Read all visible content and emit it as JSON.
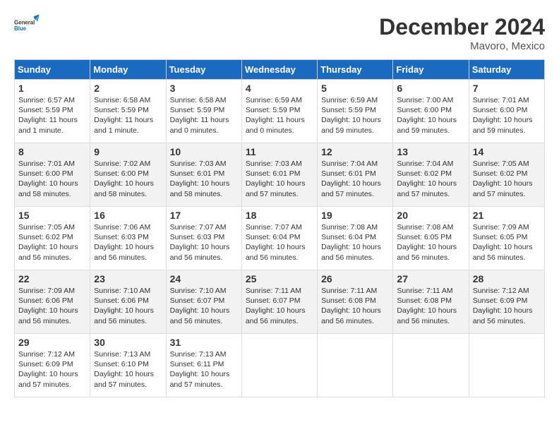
{
  "header": {
    "logo_line1": "General",
    "logo_line2": "Blue",
    "month": "December 2024",
    "location": "Mavoro, Mexico"
  },
  "weekdays": [
    "Sunday",
    "Monday",
    "Tuesday",
    "Wednesday",
    "Thursday",
    "Friday",
    "Saturday"
  ],
  "weeks": [
    [
      {
        "day": "1",
        "info": "Sunrise: 6:57 AM\nSunset: 5:59 PM\nDaylight: 11 hours\nand 1 minute."
      },
      {
        "day": "2",
        "info": "Sunrise: 6:58 AM\nSunset: 5:59 PM\nDaylight: 11 hours\nand 1 minute."
      },
      {
        "day": "3",
        "info": "Sunrise: 6:58 AM\nSunset: 5:59 PM\nDaylight: 11 hours\nand 0 minutes."
      },
      {
        "day": "4",
        "info": "Sunrise: 6:59 AM\nSunset: 5:59 PM\nDaylight: 11 hours\nand 0 minutes."
      },
      {
        "day": "5",
        "info": "Sunrise: 6:59 AM\nSunset: 5:59 PM\nDaylight: 10 hours\nand 59 minutes."
      },
      {
        "day": "6",
        "info": "Sunrise: 7:00 AM\nSunset: 6:00 PM\nDaylight: 10 hours\nand 59 minutes."
      },
      {
        "day": "7",
        "info": "Sunrise: 7:01 AM\nSunset: 6:00 PM\nDaylight: 10 hours\nand 59 minutes."
      }
    ],
    [
      {
        "day": "8",
        "info": "Sunrise: 7:01 AM\nSunset: 6:00 PM\nDaylight: 10 hours\nand 58 minutes."
      },
      {
        "day": "9",
        "info": "Sunrise: 7:02 AM\nSunset: 6:00 PM\nDaylight: 10 hours\nand 58 minutes."
      },
      {
        "day": "10",
        "info": "Sunrise: 7:03 AM\nSunset: 6:01 PM\nDaylight: 10 hours\nand 58 minutes."
      },
      {
        "day": "11",
        "info": "Sunrise: 7:03 AM\nSunset: 6:01 PM\nDaylight: 10 hours\nand 57 minutes."
      },
      {
        "day": "12",
        "info": "Sunrise: 7:04 AM\nSunset: 6:01 PM\nDaylight: 10 hours\nand 57 minutes."
      },
      {
        "day": "13",
        "info": "Sunrise: 7:04 AM\nSunset: 6:02 PM\nDaylight: 10 hours\nand 57 minutes."
      },
      {
        "day": "14",
        "info": "Sunrise: 7:05 AM\nSunset: 6:02 PM\nDaylight: 10 hours\nand 57 minutes."
      }
    ],
    [
      {
        "day": "15",
        "info": "Sunrise: 7:05 AM\nSunset: 6:02 PM\nDaylight: 10 hours\nand 56 minutes."
      },
      {
        "day": "16",
        "info": "Sunrise: 7:06 AM\nSunset: 6:03 PM\nDaylight: 10 hours\nand 56 minutes."
      },
      {
        "day": "17",
        "info": "Sunrise: 7:07 AM\nSunset: 6:03 PM\nDaylight: 10 hours\nand 56 minutes."
      },
      {
        "day": "18",
        "info": "Sunrise: 7:07 AM\nSunset: 6:04 PM\nDaylight: 10 hours\nand 56 minutes."
      },
      {
        "day": "19",
        "info": "Sunrise: 7:08 AM\nSunset: 6:04 PM\nDaylight: 10 hours\nand 56 minutes."
      },
      {
        "day": "20",
        "info": "Sunrise: 7:08 AM\nSunset: 6:05 PM\nDaylight: 10 hours\nand 56 minutes."
      },
      {
        "day": "21",
        "info": "Sunrise: 7:09 AM\nSunset: 6:05 PM\nDaylight: 10 hours\nand 56 minutes."
      }
    ],
    [
      {
        "day": "22",
        "info": "Sunrise: 7:09 AM\nSunset: 6:06 PM\nDaylight: 10 hours\nand 56 minutes."
      },
      {
        "day": "23",
        "info": "Sunrise: 7:10 AM\nSunset: 6:06 PM\nDaylight: 10 hours\nand 56 minutes."
      },
      {
        "day": "24",
        "info": "Sunrise: 7:10 AM\nSunset: 6:07 PM\nDaylight: 10 hours\nand 56 minutes."
      },
      {
        "day": "25",
        "info": "Sunrise: 7:11 AM\nSunset: 6:07 PM\nDaylight: 10 hours\nand 56 minutes."
      },
      {
        "day": "26",
        "info": "Sunrise: 7:11 AM\nSunset: 6:08 PM\nDaylight: 10 hours\nand 56 minutes."
      },
      {
        "day": "27",
        "info": "Sunrise: 7:11 AM\nSunset: 6:08 PM\nDaylight: 10 hours\nand 56 minutes."
      },
      {
        "day": "28",
        "info": "Sunrise: 7:12 AM\nSunset: 6:09 PM\nDaylight: 10 hours\nand 56 minutes."
      }
    ],
    [
      {
        "day": "29",
        "info": "Sunrise: 7:12 AM\nSunset: 6:09 PM\nDaylight: 10 hours\nand 57 minutes."
      },
      {
        "day": "30",
        "info": "Sunrise: 7:13 AM\nSunset: 6:10 PM\nDaylight: 10 hours\nand 57 minutes."
      },
      {
        "day": "31",
        "info": "Sunrise: 7:13 AM\nSunset: 6:11 PM\nDaylight: 10 hours\nand 57 minutes."
      },
      {
        "day": "",
        "info": ""
      },
      {
        "day": "",
        "info": ""
      },
      {
        "day": "",
        "info": ""
      },
      {
        "day": "",
        "info": ""
      }
    ]
  ]
}
